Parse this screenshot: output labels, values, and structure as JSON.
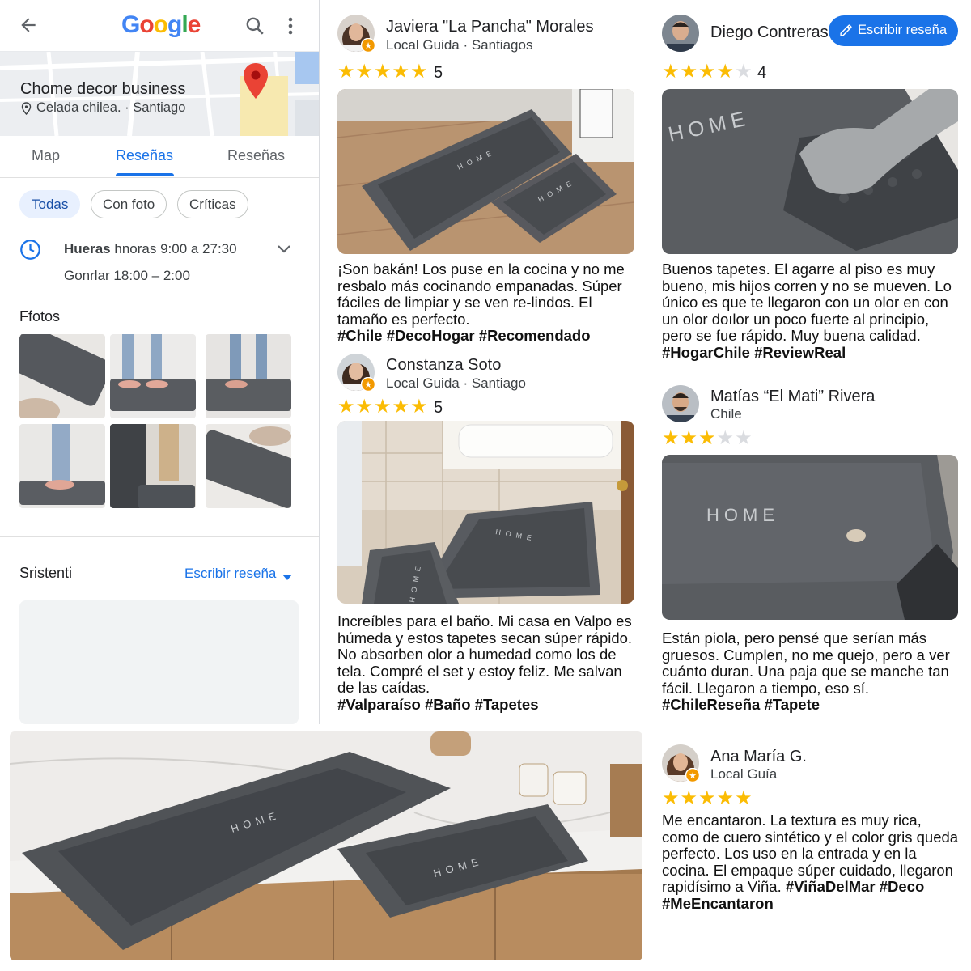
{
  "header": {
    "logo": "Google"
  },
  "business": {
    "name": "Chome decor business",
    "location": "Celada chilea. · Santiago"
  },
  "tabs": [
    "Map",
    "Reseñas",
    "Reseñas"
  ],
  "filters": [
    "Todas",
    "Con foto",
    "Críticas"
  ],
  "hours": {
    "line1_bold": "Hueras",
    "line1_rest": " hnoras 9:00 a 27:30",
    "line2": "Gonrlar 18:00 – 2:00"
  },
  "photos_title": "Ffotos",
  "bottom": {
    "label": "Sristenti",
    "write_review": "Escribir reseña"
  },
  "write_review_button": "Escribir reseña",
  "reviews": [
    {
      "name": "Javiera \"La Pancha\" Morales",
      "sub": "Local Guida · Santiagos",
      "rating": 5,
      "rating_text": "5",
      "text": "¡Son bakán! Los puse en la cocina y no me resbalo más cocinando empanadas. Súper fáciles de limpiar y se ven re-lindos. El tamaño es perfecto.",
      "tags": "#Chile #DecoHogar #Recomendado"
    },
    {
      "name": "Constanza Soto",
      "sub": "Local Guida · Santiago",
      "rating": 5,
      "rating_text": "5",
      "text": "Increíbles para el baño. Mi casa en Valpo es húmeda y estos tapetes secan súper rápido. No absorben olor a humedad como los de tela. Compré el set y estoy feliz. Me salvan de las caídas.",
      "tags": "#Valparaíso #Baño #Tapetes"
    },
    {
      "name": "Diego Contreras",
      "sub": "",
      "rating": 4,
      "rating_text": "4",
      "text": "Buenos tapetes. El agarre al piso es muy bueno, mis hijos corren y no se mueven. Lo único es que te llegaron con un olor en con un olor doılor un poco fuerte al principio, pero se fue rápido. Muy buena calidad.",
      "tags": "#HogarChile #ReviewReal"
    },
    {
      "name": "Matías “El Mati” Rivera",
      "sub": "Chile",
      "rating": 3,
      "rating_text": "",
      "text": "Están piola, pero pensé que serían más gruesos. Cumplen, no me quejo, pero a ver cuánto duran. Una paja que se manche tan fácil. Llegaron a tiempo, eso sí.",
      "tags": "#ChileReseña #Tapete"
    },
    {
      "name": "Ana María G.",
      "sub": "Local Guía",
      "rating": 5,
      "rating_text": "",
      "text": "Me encantaron. La textura es muy rica, como de cuero sintético y el color gris queda perfecto. Los uso en la entrada y en la cocina. El empaque súper cuidado, llegaron rapidísimo a Viña.",
      "tags": "#ViñaDelMar #Deco #MeEncantaron"
    }
  ],
  "mat_label": "HOME",
  "colors": {
    "accent": "#1a73e8",
    "star": "#fbbc04",
    "mat": "#4a4d52",
    "mat_border": "#5d6166"
  }
}
